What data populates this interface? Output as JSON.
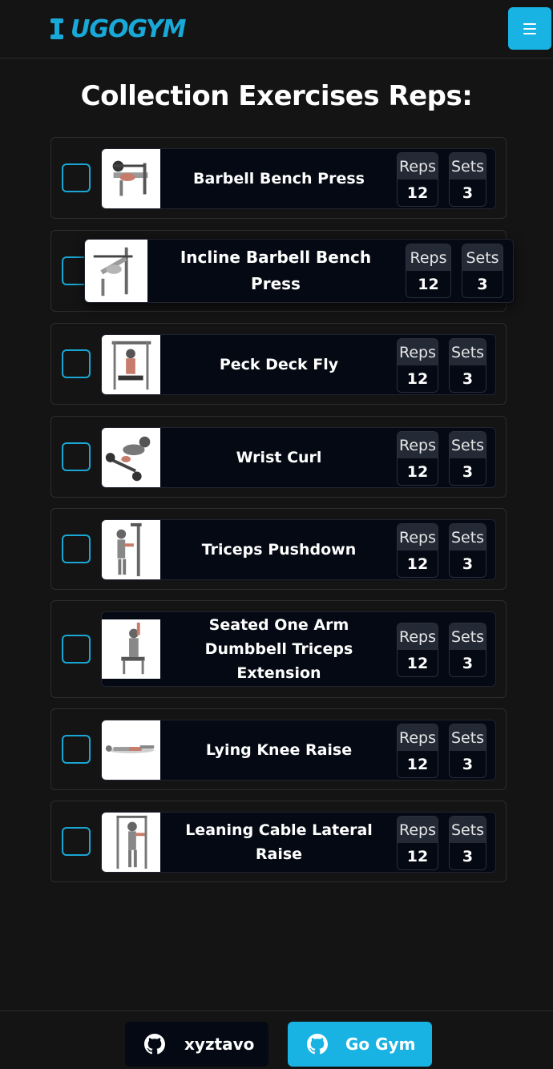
{
  "header": {
    "logo_text": "UGOGYM",
    "brand_color": "#18a9d8",
    "menu_icon": "hamburger-menu-icon"
  },
  "page_title": "Collection Exercises Reps:",
  "exercises": [
    {
      "name": "Barbell Bench Press",
      "reps_label": "Reps",
      "reps": "12",
      "sets_label": "Sets",
      "sets": "3",
      "checked": false
    },
    {
      "name": "Incline Barbell Bench Press",
      "reps_label": "Reps",
      "reps": "12",
      "sets_label": "Sets",
      "sets": "3",
      "checked": false,
      "dragging": true
    },
    {
      "name": "Peck Deck Fly",
      "reps_label": "Reps",
      "reps": "12",
      "sets_label": "Sets",
      "sets": "3",
      "checked": false
    },
    {
      "name": "Wrist Curl",
      "reps_label": "Reps",
      "reps": "12",
      "sets_label": "Sets",
      "sets": "3",
      "checked": false
    },
    {
      "name": "Triceps Pushdown",
      "reps_label": "Reps",
      "reps": "12",
      "sets_label": "Sets",
      "sets": "3",
      "checked": false
    },
    {
      "name": "Seated One Arm Dumbbell Triceps Extension",
      "reps_label": "Reps",
      "reps": "12",
      "sets_label": "Sets",
      "sets": "3",
      "checked": false
    },
    {
      "name": "Lying Knee Raise",
      "reps_label": "Reps",
      "reps": "12",
      "sets_label": "Sets",
      "sets": "3",
      "checked": false
    },
    {
      "name": "Leaning Cable Lateral Raise",
      "reps_label": "Reps",
      "reps": "12",
      "sets_label": "Sets",
      "sets": "3",
      "checked": false
    }
  ],
  "footer": {
    "github_user_label": "xyztavo",
    "go_gym_label": "Go Gym",
    "accent_color": "#18b3e3"
  }
}
